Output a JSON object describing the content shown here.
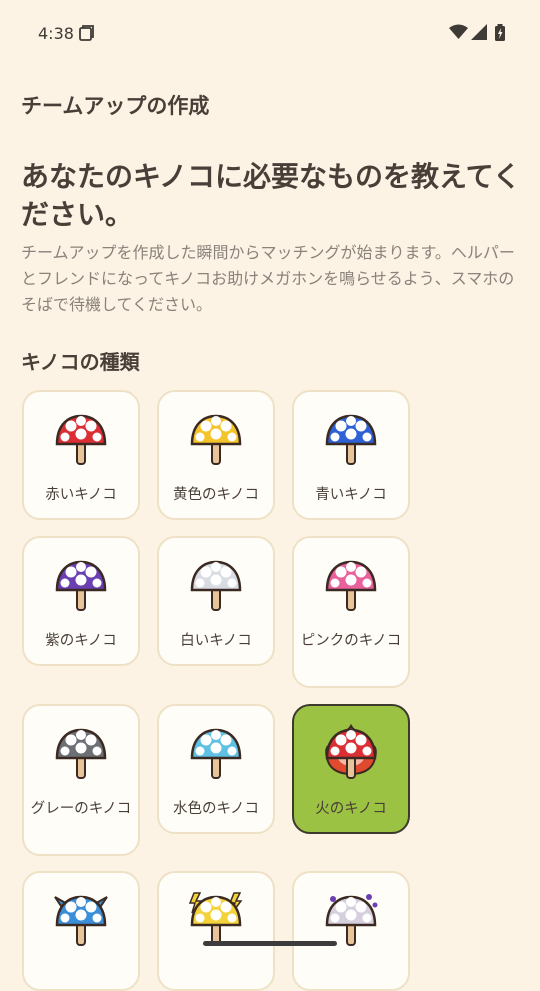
{
  "status": {
    "time": "4:38",
    "icons": [
      "sim-card-icon",
      "wifi-icon",
      "signal-icon",
      "battery-icon"
    ]
  },
  "appbar": {
    "title": "チームアップの作成"
  },
  "headline": "あなたのキノコに必要なものを教えてください。",
  "description": "チームアップを作成した瞬間からマッチングが始まります。ヘルパーとフレンドになってキノコお助けメガホンを鳴らせるよう、スマホのそばで待機してください。",
  "section": {
    "title": "キノコの種類"
  },
  "mushrooms": [
    {
      "label": "赤いキノコ",
      "cap": "#DC2F35",
      "selected": false
    },
    {
      "label": "黄色のキノコ",
      "cap": "#F3C52B",
      "selected": false
    },
    {
      "label": "青いキノコ",
      "cap": "#2E60D6",
      "selected": false
    },
    {
      "label": "紫のキノコ",
      "cap": "#6A3FB2",
      "selected": false
    },
    {
      "label": "白いキノコ",
      "cap": "#D9DCE2",
      "selected": false
    },
    {
      "label": "ピンクのキノコ",
      "cap": "#E9609A",
      "selected": false
    },
    {
      "label": "グレーのキノコ",
      "cap": "#6C6F74",
      "selected": false
    },
    {
      "label": "水色のキノコ",
      "cap": "#5EC1E4",
      "selected": false
    },
    {
      "label": "火のキノコ",
      "cap": "#DC2F35",
      "selected": true
    },
    {
      "label": "",
      "cap": "#3B8FD9",
      "selected": false
    },
    {
      "label": "",
      "cap": "#F3D33A",
      "selected": false
    },
    {
      "label": "",
      "cap": "#D6D0DE",
      "selected": false
    }
  ]
}
